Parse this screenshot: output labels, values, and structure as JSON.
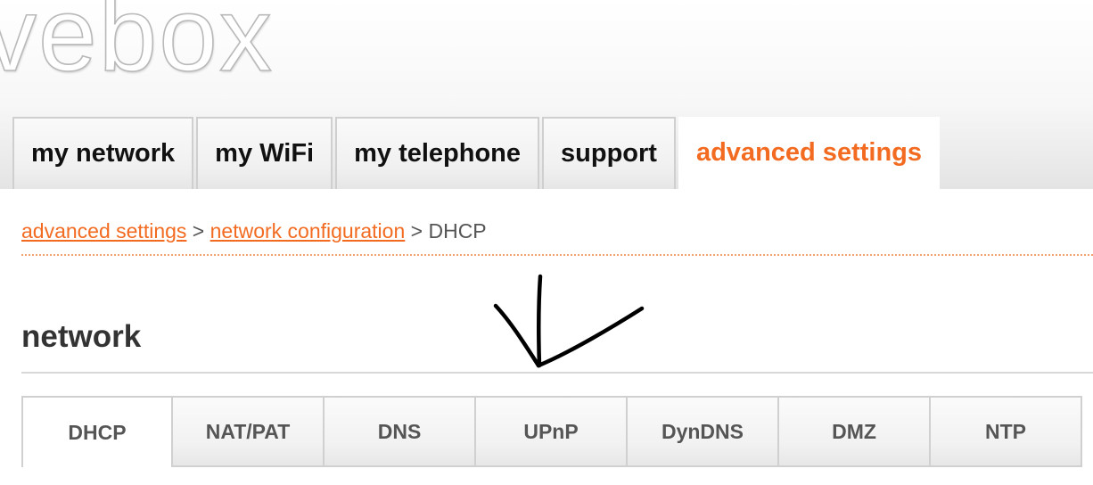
{
  "logo": {
    "text": "vebox"
  },
  "main_tabs": [
    {
      "label": "my network"
    },
    {
      "label": "my WiFi"
    },
    {
      "label": "my telephone"
    },
    {
      "label": "support"
    },
    {
      "label": "advanced settings",
      "active": true
    }
  ],
  "breadcrumb": {
    "link1": "advanced settings",
    "sep1": " > ",
    "link2": "network configuration",
    "sep2": " > ",
    "current": "DHCP"
  },
  "section": {
    "title": "network"
  },
  "sub_tabs": [
    {
      "label": "DHCP",
      "active": true
    },
    {
      "label": "NAT/PAT"
    },
    {
      "label": "DNS"
    },
    {
      "label": "UPnP"
    },
    {
      "label": "DynDNS"
    },
    {
      "label": "DMZ"
    },
    {
      "label": "NTP"
    }
  ],
  "colors": {
    "accent": "#f26b21",
    "text": "#111111",
    "muted": "#555555"
  }
}
